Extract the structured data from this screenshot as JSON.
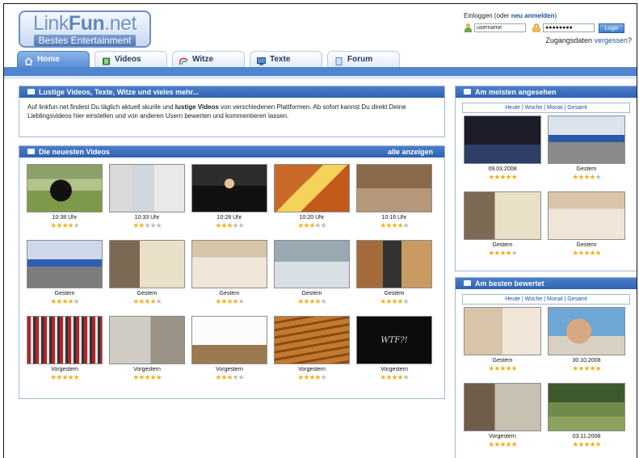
{
  "header": {
    "logo_text_1": "Link",
    "logo_text_2": "Fun",
    "logo_text_3": ".net",
    "logo_tagline": "Bestes Entertainment"
  },
  "login": {
    "line_prefix": "Einloggen (oder ",
    "register_link": "neu anmelden",
    "line_suffix": ")",
    "username_value": "username",
    "password_value": "●●●●●●●●",
    "login_button": "Login",
    "forgot_prefix": "Zugangsdaten ",
    "forgot_link": "vergessen",
    "forgot_suffix": "?"
  },
  "tabs": [
    {
      "label": "Home",
      "icon": "home-icon",
      "active": true
    },
    {
      "label": "Videos",
      "icon": "film-icon",
      "active": false
    },
    {
      "label": "Witze",
      "icon": "rainbow-icon",
      "active": false
    },
    {
      "label": "Texte",
      "icon": "monitor-icon",
      "active": false
    },
    {
      "label": "Forum",
      "icon": "document-icon",
      "active": false
    }
  ],
  "intro": {
    "heading": "Lustige Videos, Texte, Witze und vieles mehr...",
    "text_1": "Auf linkfun.net findest Du täglich aktuell skurile und ",
    "text_bold": "lustige Videos",
    "text_2": " von verschiedenen Plattformen. Ab sofort kannst Du direkt Deine Lieblingsvideos hier einstellen und von anderen Usern bewerten und kommentieren lassen."
  },
  "newest": {
    "heading": "Die neuesten Videos",
    "show_all": "alle anzeigen",
    "videos": [
      {
        "time": "10:38 Uhr",
        "rating": 4,
        "thumb": "t-dog"
      },
      {
        "time": "10:33 Uhr",
        "rating": 2,
        "thumb": "t-office"
      },
      {
        "time": "10:28 Uhr",
        "rating": 3,
        "thumb": "t-suit"
      },
      {
        "time": "10:20 Uhr",
        "rating": 3,
        "thumb": "t-cat1"
      },
      {
        "time": "10:16 Uhr",
        "rating": 4,
        "thumb": "t-cat2"
      },
      {
        "time": "Gestern",
        "rating": 4,
        "thumb": "t-pingpong"
      },
      {
        "time": "Gestern",
        "rating": 4,
        "thumb": "t-kitchen"
      },
      {
        "time": "Gestern",
        "rating": 4,
        "thumb": "t-shelf"
      },
      {
        "time": "Gestern",
        "rating": 4,
        "thumb": "t-storm"
      },
      {
        "time": "Gestern",
        "rating": 4,
        "thumb": "t-room"
      },
      {
        "time": "Vorgestern",
        "rating": 5,
        "thumb": "t-crowd"
      },
      {
        "time": "Vorgestern",
        "rating": 5,
        "thumb": "t-washer"
      },
      {
        "time": "Vorgestern",
        "rating": 3,
        "thumb": "t-dance"
      },
      {
        "time": "Vorgestern",
        "rating": 4,
        "thumb": "t-stairs"
      },
      {
        "time": "Vorgestern",
        "rating": 4,
        "thumb": "t-wtf",
        "overlay": "WTF?!"
      }
    ]
  },
  "most_viewed": {
    "heading": "Am meisten angesehen",
    "filters": [
      "Heute",
      "Woche",
      "Monat",
      "Gesamt"
    ],
    "videos": [
      {
        "time": "09.03.2008",
        "rating": 5,
        "thumb": "t-news"
      },
      {
        "time": "Gestern",
        "rating": 4,
        "thumb": "t-pp2"
      },
      {
        "time": "Gestern",
        "rating": 4,
        "thumb": "t-kitchen"
      },
      {
        "time": "Gestern",
        "rating": 5,
        "thumb": "t-shelf"
      }
    ]
  },
  "best_rated": {
    "heading": "Am besten bewertet",
    "filters": [
      "Heute",
      "Woche",
      "Monat",
      "Gesamt"
    ],
    "videos": [
      {
        "time": "Gestern",
        "rating": 5,
        "thumb": "t-kitchen2"
      },
      {
        "time": "30.10.2008",
        "rating": 5,
        "thumb": "t-boy"
      },
      {
        "time": "Vorgestern",
        "rating": 5,
        "thumb": "t-piano"
      },
      {
        "time": "03.11.2008",
        "rating": 5,
        "thumb": "t-girl"
      }
    ]
  },
  "colors": {
    "nav_blue": "#4f86d0",
    "link_blue": "#1f4f9c",
    "star_gold": "#f0b221"
  }
}
